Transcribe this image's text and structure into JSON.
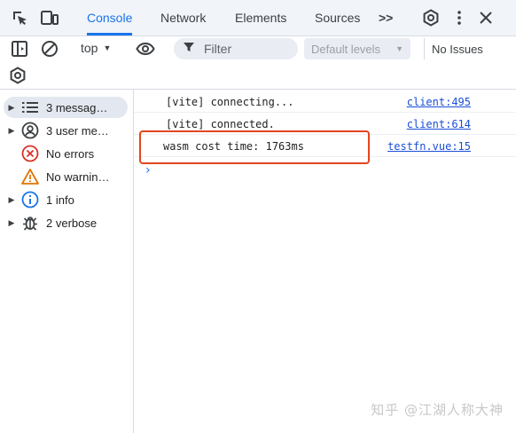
{
  "tabs": {
    "items": [
      {
        "label": "Console",
        "active": true
      },
      {
        "label": "Network",
        "active": false
      },
      {
        "label": "Elements",
        "active": false
      },
      {
        "label": "Sources",
        "active": false
      }
    ],
    "more_label": ">>"
  },
  "toolbar": {
    "context": "top",
    "filter_placeholder": "Filter",
    "levels_label": "Default levels",
    "issues_label": "No Issues"
  },
  "sidebar": {
    "items": [
      {
        "icon": "list-icon",
        "label": "3 messag…",
        "expandable": true,
        "selected": true
      },
      {
        "icon": "user-icon",
        "label": "3 user me…",
        "expandable": true,
        "selected": false
      },
      {
        "icon": "error-icon",
        "label": "No errors",
        "expandable": false,
        "selected": false
      },
      {
        "icon": "warning-icon",
        "label": "No warnin…",
        "expandable": false,
        "selected": false
      },
      {
        "icon": "info-icon",
        "label": "1 info",
        "expandable": true,
        "selected": false
      },
      {
        "icon": "bug-icon",
        "label": "2 verbose",
        "expandable": true,
        "selected": false
      }
    ]
  },
  "log": [
    {
      "message": "[vite] connecting...",
      "source": "client:495"
    },
    {
      "message": "[vite] connected.",
      "source": "client:614"
    },
    {
      "message": "wasm cost time: 1763ms",
      "source": "testfn.vue:15"
    }
  ],
  "watermark": "知乎 @江湖人称大神",
  "colors": {
    "accent": "#1a73e8",
    "highlight_border": "#e2461f",
    "link": "#1a4ed8"
  }
}
